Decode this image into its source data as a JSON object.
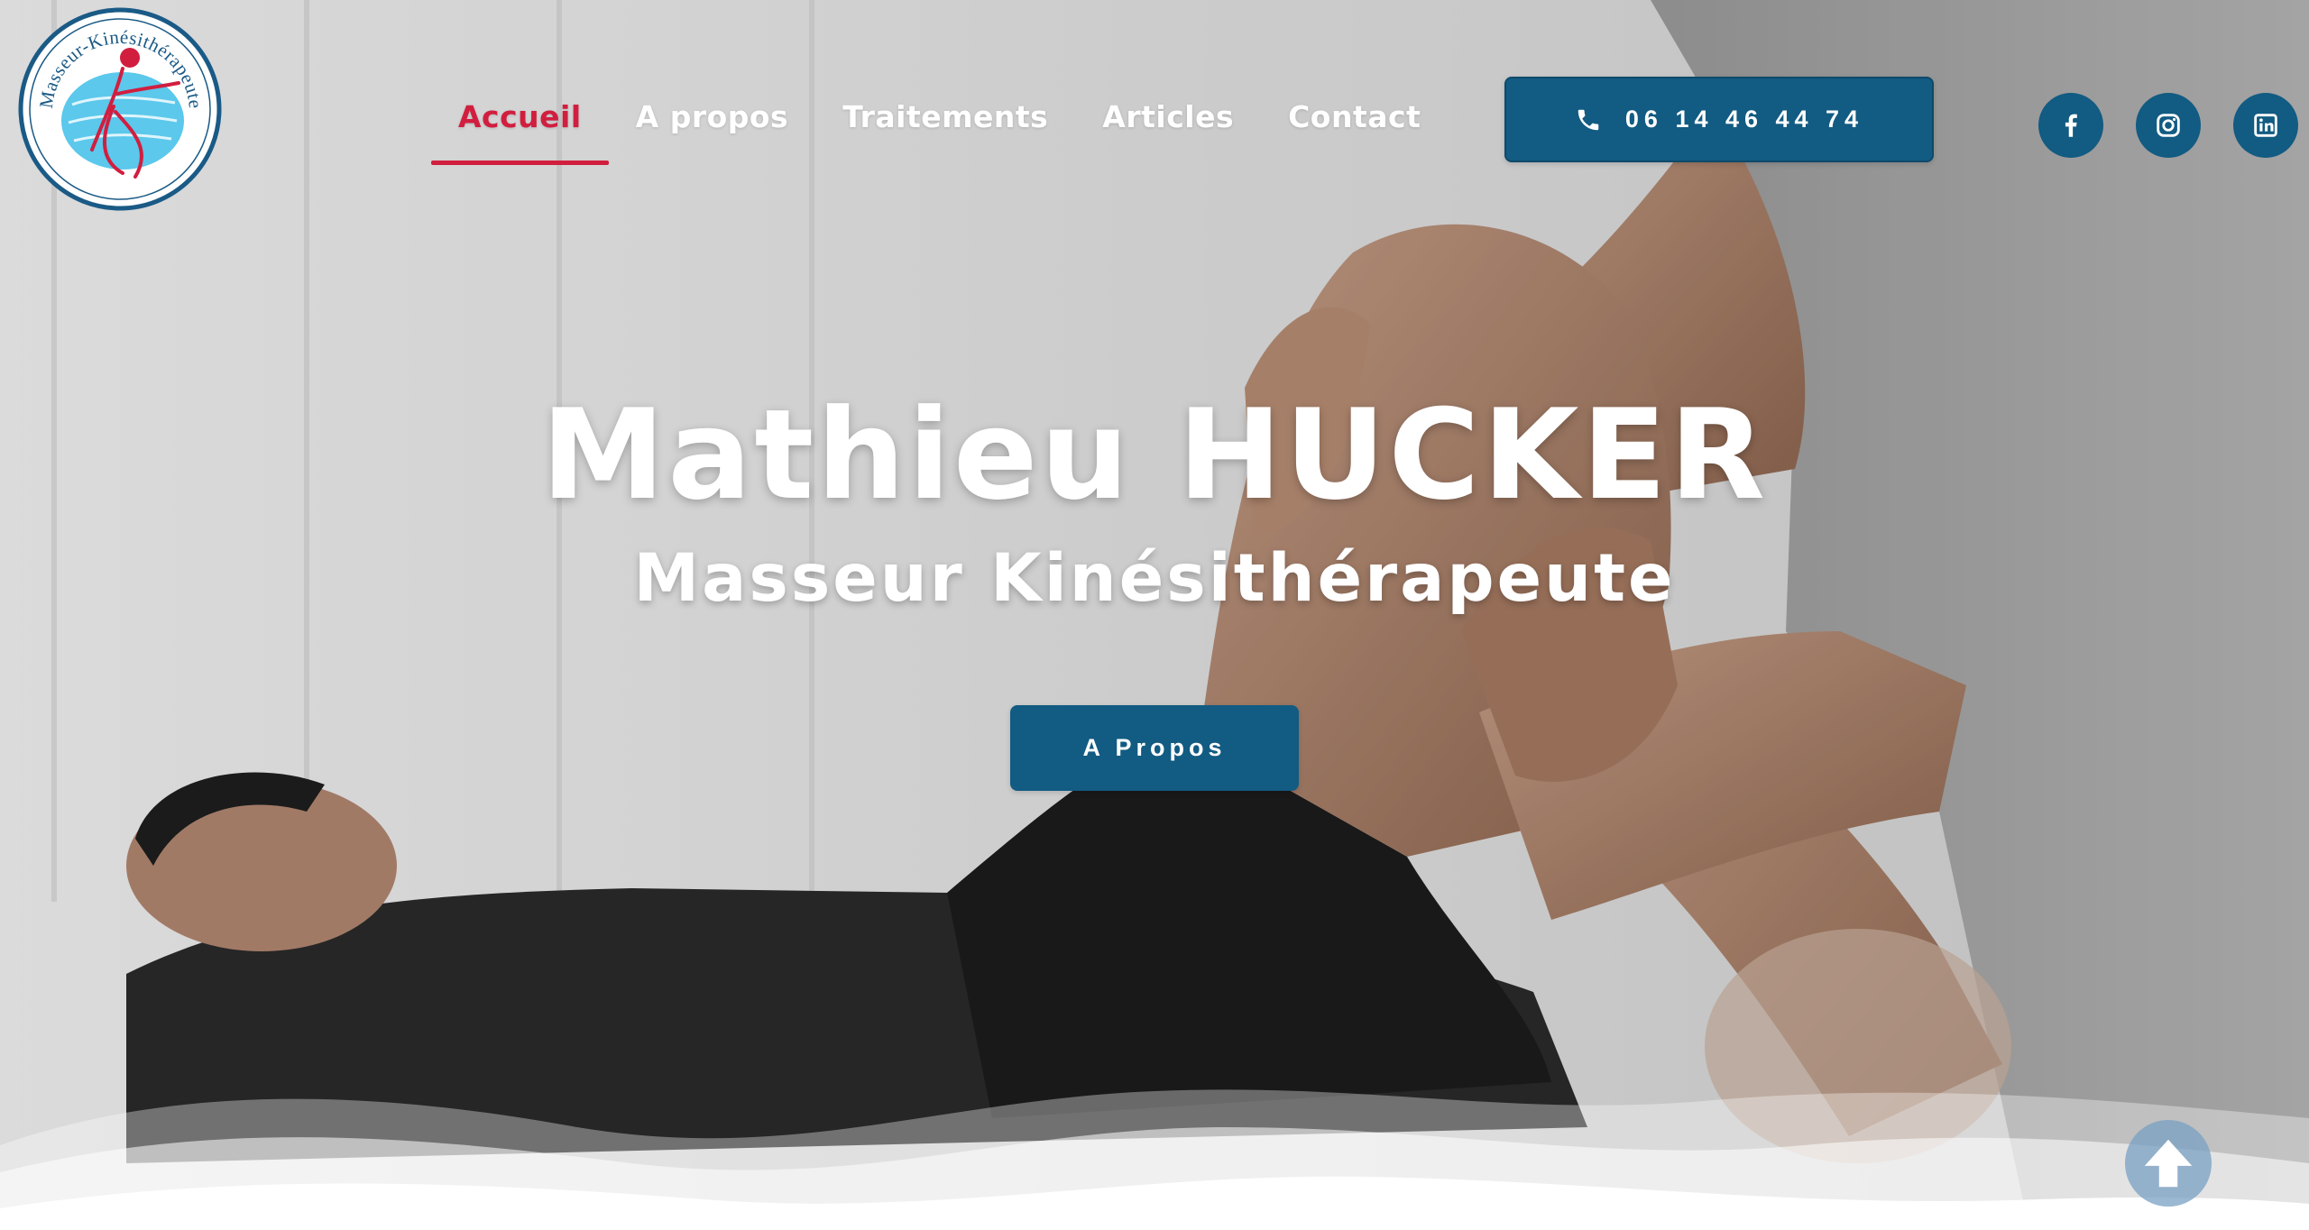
{
  "logo": {
    "text": "Masseur-Kinésithérapeute",
    "colors": {
      "ring": "#1a5a86",
      "water": "#5bc8ec",
      "figure": "#d11e3f"
    }
  },
  "nav": {
    "items": [
      {
        "label": "Accueil",
        "active": true
      },
      {
        "label": "A propos",
        "active": false
      },
      {
        "label": "Traitements",
        "active": false
      },
      {
        "label": "Articles",
        "active": false
      },
      {
        "label": "Contact",
        "active": false
      }
    ]
  },
  "header": {
    "phone_label": "06 14 46 44 74",
    "phone_icon": "phone-icon",
    "social": [
      {
        "name": "facebook",
        "icon": "facebook-icon"
      },
      {
        "name": "instagram",
        "icon": "instagram-icon"
      },
      {
        "name": "linkedin",
        "icon": "linkedin-icon"
      }
    ]
  },
  "hero": {
    "title": "Mathieu HUCKER",
    "subtitle": "Masseur Kinésithérapeute",
    "cta_label": "A Propos"
  },
  "scroll_top": {
    "icon": "arrow-up-icon"
  },
  "colors": {
    "brand_blue": "#125b82",
    "accent_red": "#d11e3f",
    "text_white": "#ffffff"
  }
}
